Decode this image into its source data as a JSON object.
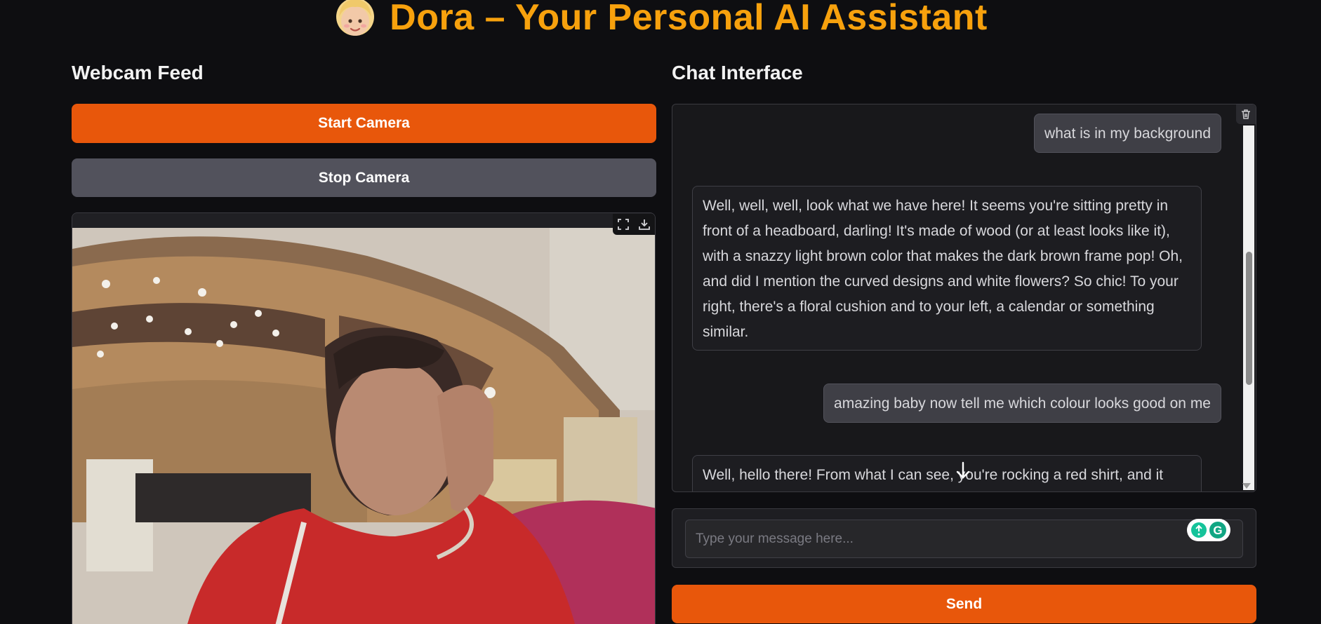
{
  "header": {
    "title": "Dora – Your Personal AI Assistant",
    "emoji_icon": "blonde-girl-emoji",
    "title_color": "#f7a10d"
  },
  "webcam": {
    "heading": "Webcam Feed",
    "start_label": "Start Camera",
    "stop_label": "Stop Camera",
    "fullscreen_icon": "fullscreen-icon",
    "download_icon": "download-icon"
  },
  "chat": {
    "heading": "Chat Interface",
    "messages": [
      {
        "role": "user",
        "text": "what is in my background"
      },
      {
        "role": "assistant",
        "text": "Well, well, well, look what we have here! It seems you're sitting pretty in front of a headboard, darling! It's made of wood (or at least looks like it), with a snazzy light brown color that makes the dark brown frame pop! Oh, and did I mention the curved designs and white flowers? So chic! To your right, there's a floral cushion and to your left, a calendar or something similar."
      },
      {
        "role": "user",
        "text": "amazing baby now tell me which colour looks good on me"
      },
      {
        "role": "assistant",
        "text": "Well, hello there! From what I can see, you're rocking a red shirt, and it"
      }
    ],
    "input_placeholder": "Type your message here...",
    "send_label": "Send",
    "clear_icon": "trash-icon",
    "scroll_down_icon": "arrow-down-icon"
  },
  "colors": {
    "primary": "#e8570b",
    "secondary": "#52525c",
    "background": "#0e0e11"
  }
}
